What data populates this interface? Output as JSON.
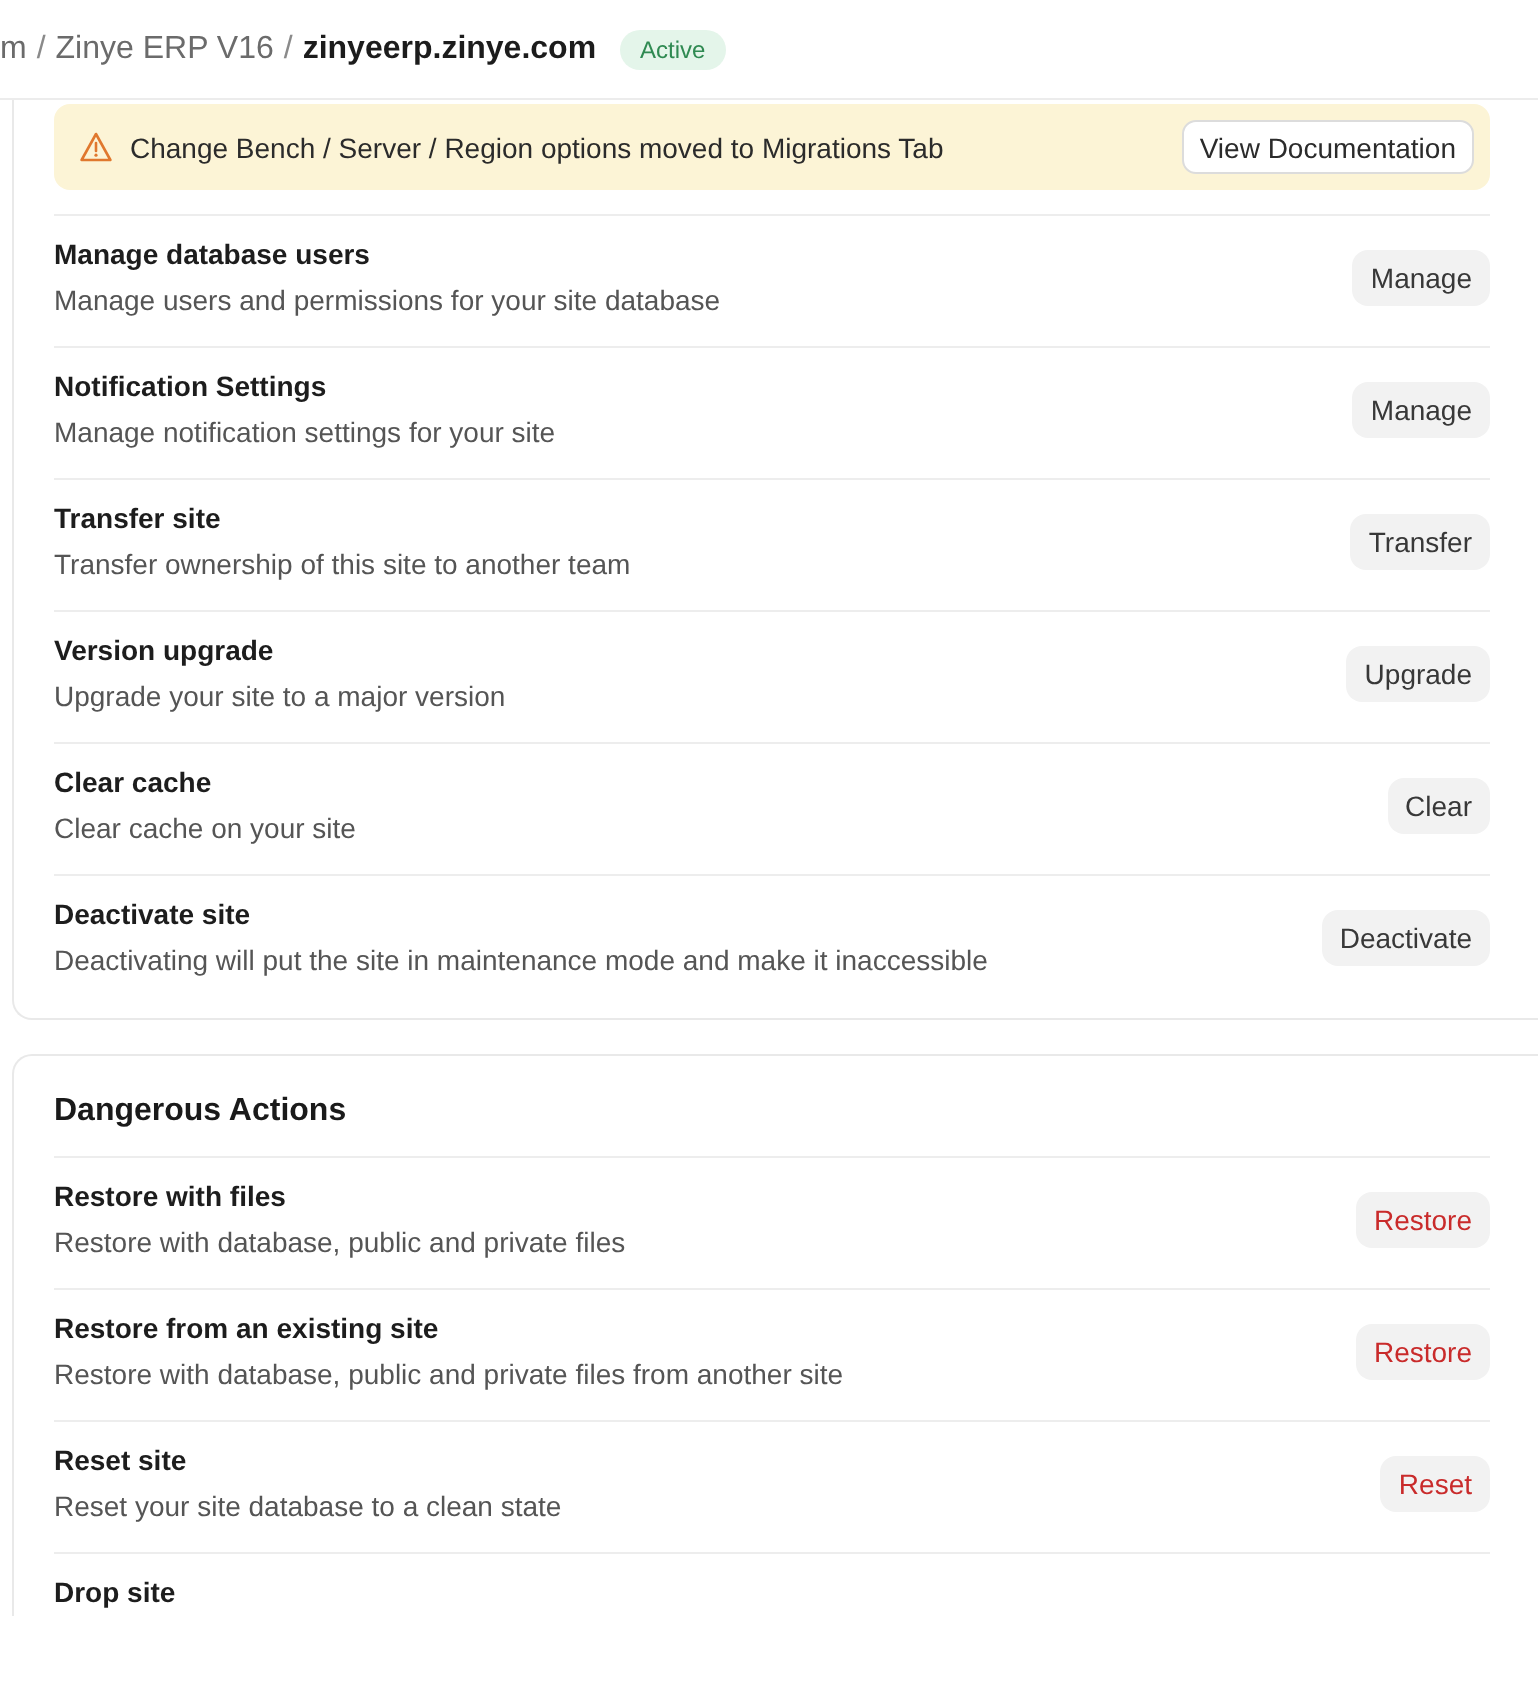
{
  "breadcrumb": {
    "items": [
      {
        "label": "m",
        "separator": "/"
      },
      {
        "label": "Zinye ERP V16",
        "separator": "/"
      },
      {
        "label": "zinyeerp.zinye.com"
      }
    ],
    "badge": {
      "label": "Active",
      "kind": "success"
    }
  },
  "settings_card": {
    "notice": {
      "kind": "warning",
      "text": "Change Bench / Server / Region options moved to Migrations Tab",
      "button": "View Documentation"
    },
    "rows": [
      {
        "title": "Manage database users",
        "description": "Manage users and permissions for your site database",
        "button": {
          "label": "Manage",
          "kind": "default"
        }
      },
      {
        "title": "Notification Settings",
        "description": "Manage notification settings for your site",
        "button": {
          "label": "Manage",
          "kind": "default"
        }
      },
      {
        "title": "Transfer site",
        "description": "Transfer ownership of this site to another team",
        "button": {
          "label": "Transfer",
          "kind": "default"
        }
      },
      {
        "title": "Version upgrade",
        "description": "Upgrade your site to a major version",
        "button": {
          "label": "Upgrade",
          "kind": "default"
        }
      },
      {
        "title": "Clear cache",
        "description": "Clear cache on your site",
        "button": {
          "label": "Clear",
          "kind": "default"
        }
      },
      {
        "title": "Deactivate site",
        "description": "Deactivating will put the site in maintenance mode and make it inaccessible",
        "button": {
          "label": "Deactivate",
          "kind": "default"
        }
      }
    ]
  },
  "danger_card": {
    "title": "Dangerous Actions",
    "rows": [
      {
        "title": "Restore with files",
        "description": "Restore with database, public and private files",
        "button": {
          "label": "Restore",
          "kind": "danger"
        }
      },
      {
        "title": "Restore from an existing site",
        "description": "Restore with database, public and private files from another site",
        "button": {
          "label": "Restore",
          "kind": "danger"
        }
      },
      {
        "title": "Reset site",
        "description": "Reset your site database to a clean state",
        "button": {
          "label": "Reset",
          "kind": "danger"
        }
      },
      {
        "title": "Drop site"
      }
    ]
  }
}
